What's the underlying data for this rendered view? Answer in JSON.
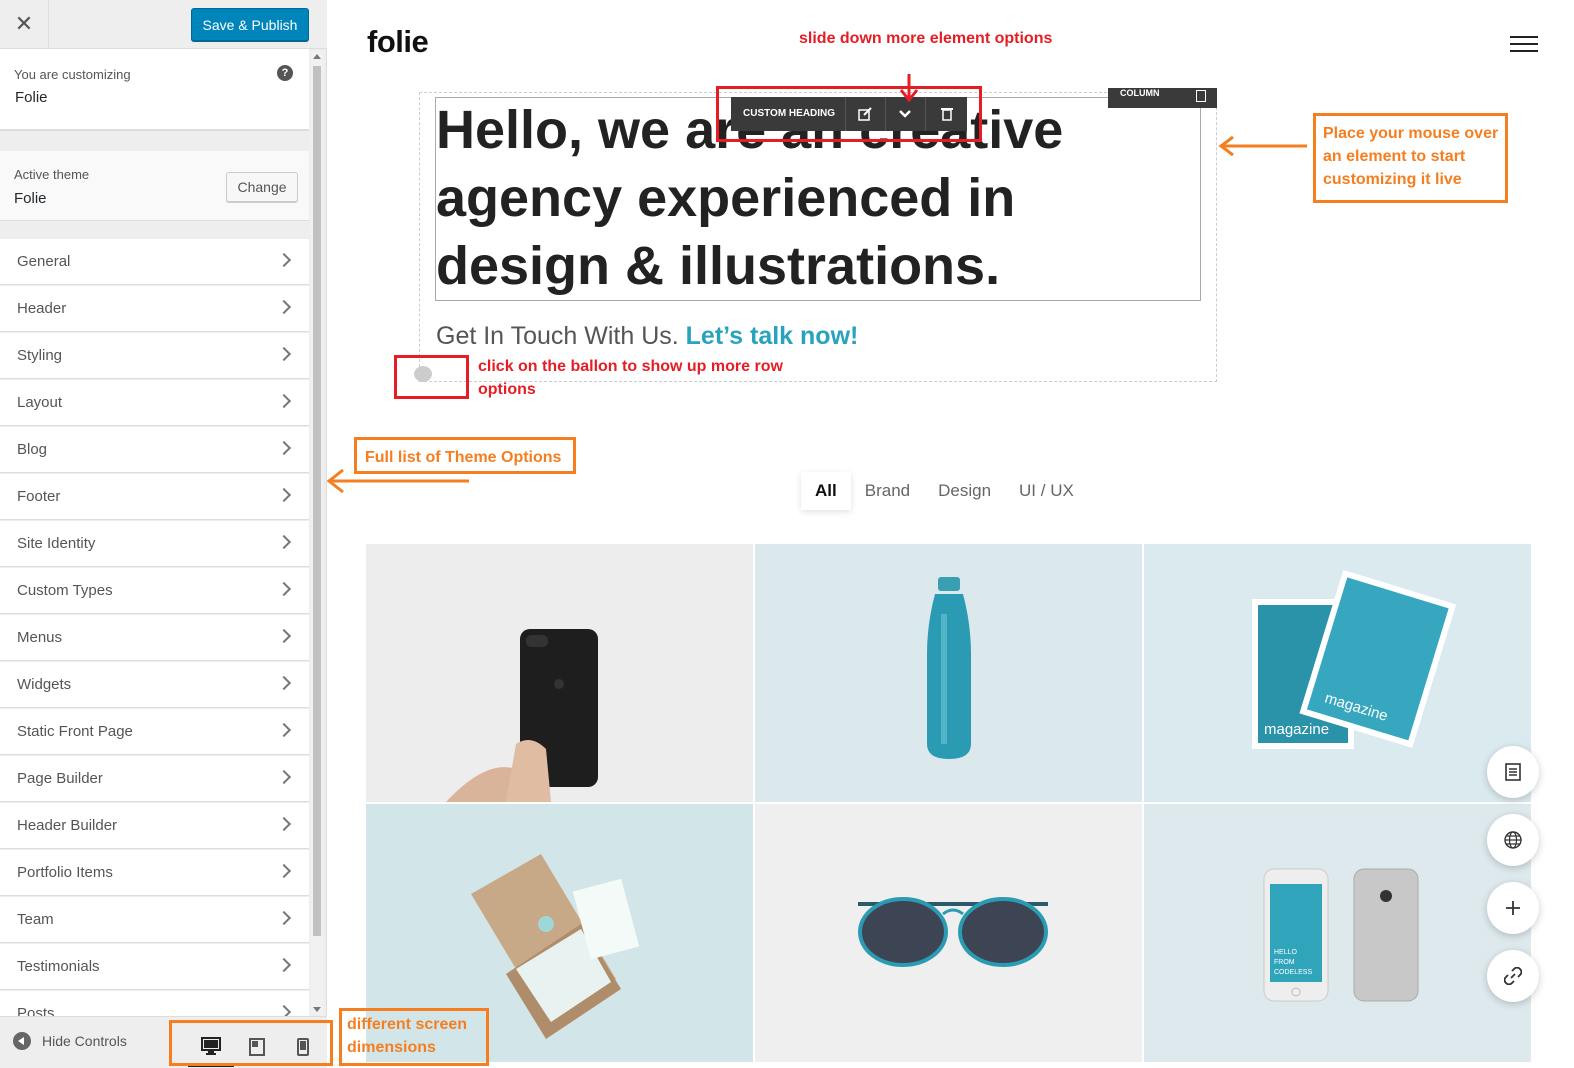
{
  "sidebar": {
    "close_icon": "close-icon",
    "save_label": "Save & Publish",
    "customizing_label": "You are customizing",
    "customizing_value": "Folie",
    "active_theme_label": "Active theme",
    "active_theme_value": "Folie",
    "change_label": "Change",
    "items": [
      {
        "label": "General"
      },
      {
        "label": "Header"
      },
      {
        "label": "Styling"
      },
      {
        "label": "Layout"
      },
      {
        "label": "Blog"
      },
      {
        "label": "Footer"
      },
      {
        "label": "Site Identity"
      },
      {
        "label": "Custom Types"
      },
      {
        "label": "Menus"
      },
      {
        "label": "Widgets"
      },
      {
        "label": "Static Front Page"
      },
      {
        "label": "Page Builder"
      },
      {
        "label": "Header Builder"
      },
      {
        "label": "Portfolio Items"
      },
      {
        "label": "Team"
      },
      {
        "label": "Testimonials"
      },
      {
        "label": "Posts"
      }
    ],
    "hide_controls": "Hide Controls",
    "devices": [
      "desktop-icon",
      "tablet-icon",
      "mobile-icon"
    ]
  },
  "preview": {
    "logo": "folie",
    "headline": "Hello, we are an creative agency experienced in design & illustrations.",
    "subline_prefix": "Get In Touch With Us. ",
    "subline_cta": "Let’s talk now!",
    "toolbar_label": "CUSTOM HEADING",
    "column_label": "COLUMN",
    "filters": [
      "All",
      "Brand",
      "Design",
      "UI / UX"
    ],
    "active_filter": "All",
    "accent": "#28a3bb"
  },
  "annotations": {
    "slide_down": "slide down more element options",
    "place_mouse": "Place your mouse over an element to start customizing it live",
    "balloon": "click on the ballon to show up more row options",
    "theme_options": "Full list of Theme Options",
    "screen_dims": "different screen dimensions"
  },
  "colors": {
    "primary_button": "#0085ba",
    "annotation_red": "#e51e25",
    "annotation_orange": "#f57f20",
    "accent_teal": "#28a3bb"
  }
}
